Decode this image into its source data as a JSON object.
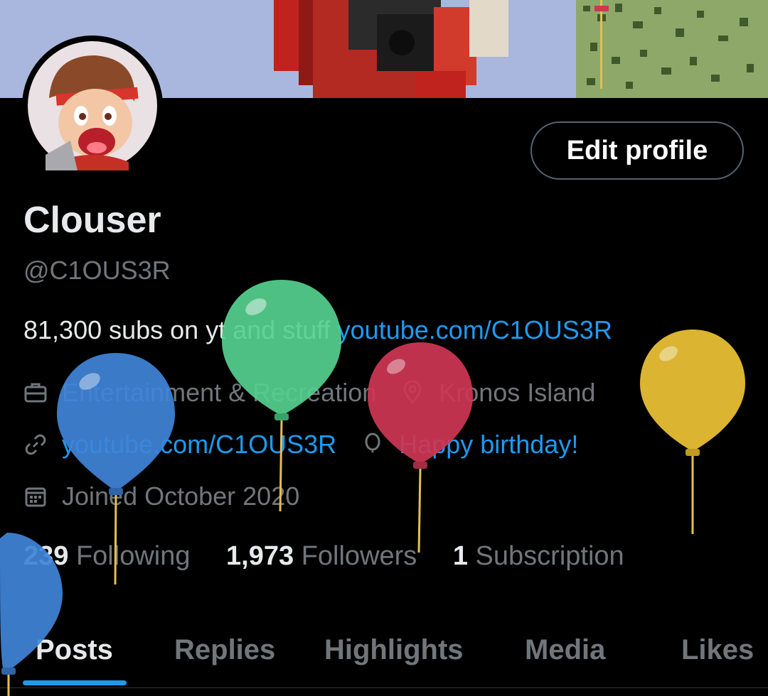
{
  "profile": {
    "name": "Clouser",
    "handle": "@C1OUS3R",
    "bio_text": "81,300 subs on yt and stuff ",
    "bio_link": "youtube.com/C1OUS3R",
    "category": "Entertainment & Recreation",
    "location": "Kronos Island",
    "website": "youtube.com/C1OUS3R",
    "birthday": "Happy birthday!",
    "joined": "Joined October 2020"
  },
  "actions": {
    "edit_profile": "Edit profile"
  },
  "stats": {
    "following_count": "239",
    "following_label": " Following",
    "followers_count": "1,973",
    "followers_label": " Followers",
    "subscriptions_count": "1",
    "subscriptions_label": " Subscription"
  },
  "tabs": [
    "Posts",
    "Replies",
    "Highlights",
    "Media",
    "Likes"
  ],
  "icons": {
    "category": "briefcase-icon",
    "location": "location-pin-icon",
    "website": "link-icon",
    "birthday": "balloon-icon",
    "joined": "calendar-icon"
  },
  "colors": {
    "background": "#000000",
    "text": "#e7e9ea",
    "secondary": "#71767b",
    "accent": "#1d9bf0",
    "balloon_blue": "#3f84d8",
    "balloon_green": "#56d08e",
    "balloon_red": "#cf3654",
    "balloon_yellow": "#e7be35"
  }
}
